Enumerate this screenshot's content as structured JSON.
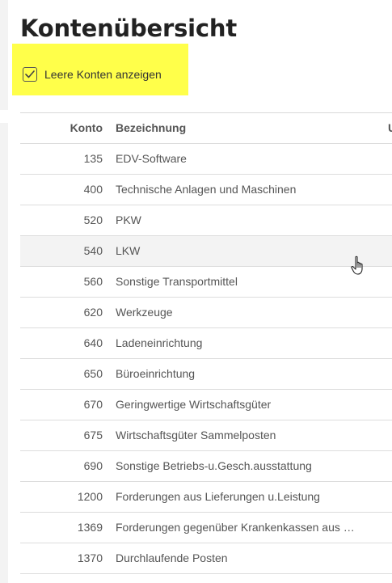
{
  "page": {
    "title": "Kontenübersicht"
  },
  "filter": {
    "checkbox_label": "Leere Konten anzeigen",
    "checked": true
  },
  "table": {
    "columns": [
      "Konto",
      "Bezeichnung",
      "U"
    ],
    "rows": [
      {
        "konto": "135",
        "bezeichnung": "EDV-Software"
      },
      {
        "konto": "400",
        "bezeichnung": "Technische Anlagen und Maschinen"
      },
      {
        "konto": "520",
        "bezeichnung": "PKW"
      },
      {
        "konto": "540",
        "bezeichnung": "LKW"
      },
      {
        "konto": "560",
        "bezeichnung": "Sonstige Transportmittel"
      },
      {
        "konto": "620",
        "bezeichnung": "Werkzeuge"
      },
      {
        "konto": "640",
        "bezeichnung": "Ladeneinrichtung"
      },
      {
        "konto": "650",
        "bezeichnung": "Büroeinrichtung"
      },
      {
        "konto": "670",
        "bezeichnung": "Geringwertige Wirtschaftsgüter"
      },
      {
        "konto": "675",
        "bezeichnung": "Wirtschaftsgüter Sammelposten"
      },
      {
        "konto": "690",
        "bezeichnung": "Sonstige Betriebs-u.Gesch.ausstattung"
      },
      {
        "konto": "1200",
        "bezeichnung": "Forderungen aus Lieferungen u.Leistung"
      },
      {
        "konto": "1369",
        "bezeichnung": "Forderungen gegenüber Krankenkassen aus …"
      },
      {
        "konto": "1370",
        "bezeichnung": "Durchlaufende Posten"
      }
    ]
  },
  "colors": {
    "highlight": "#ffff4a",
    "hover_row": "#f3f3f3"
  },
  "icons": {
    "checkbox": "checkmark-icon",
    "cursor": "hand-pointer-icon"
  }
}
